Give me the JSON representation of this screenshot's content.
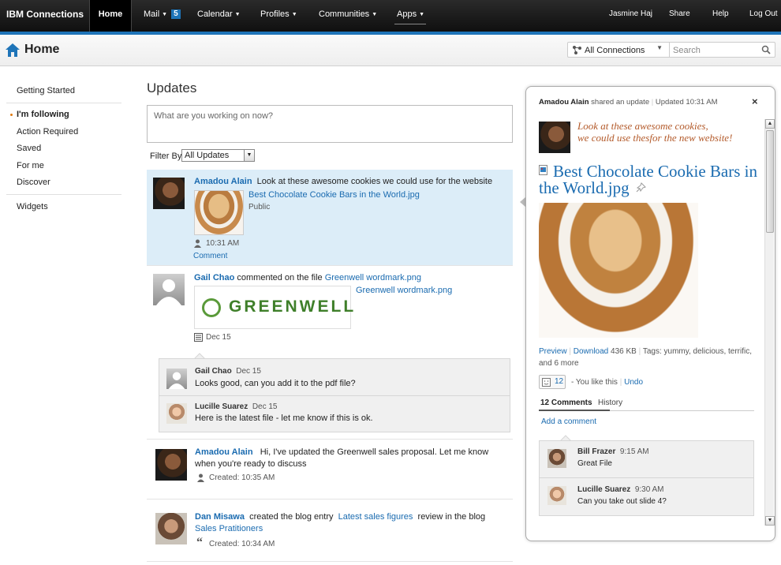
{
  "topnav": {
    "brand": "IBM Connections",
    "items": [
      "Home",
      "Mail",
      "Calendar",
      "Profiles",
      "Communities",
      "Apps"
    ],
    "mail_badge": "5",
    "user": "Jasmine Haj",
    "share": "Share",
    "help": "Help",
    "logout": "Log Out"
  },
  "header": {
    "title": "Home",
    "scope": "All Connections",
    "search_placeholder": "Search"
  },
  "leftnav": {
    "getting_started": "Getting Started",
    "items": [
      "I'm following",
      "Action Required",
      "Saved",
      "For me",
      "Discover"
    ],
    "widgets": "Widgets"
  },
  "main": {
    "title": "Updates",
    "status_placeholder": "What are you working on now?",
    "filter_label": "Filter By:",
    "filter_value": "All Updates"
  },
  "stories": [
    {
      "author": "Amadou Alain",
      "text": "Look at these awesome cookies we could use for the website",
      "file": "Best Chocolate Cookie Bars in the World.jpg",
      "visibility": "Public",
      "time": "10:31 AM",
      "action": "Comment"
    },
    {
      "author": "Gail Chao",
      "text": "commented on the file",
      "file": "Greenwell wordmark.png",
      "file2": "Greenwell wordmark.png",
      "logo_text": "GREENWELL",
      "date": "Dec 15",
      "comments": [
        {
          "author": "Gail Chao",
          "date": "Dec 15",
          "text": "Looks good, can you add it to the pdf file?"
        },
        {
          "author": "Lucille Suarez",
          "date": "Dec 15",
          "text": "Here is the latest file - let me know if this is ok."
        }
      ]
    },
    {
      "author": "Amadou Alain",
      "text_line1": "Hi, I've updated the Greenwell sales proposal.  Let me know",
      "text_line2": "when you're ready to discuss",
      "time": "Created: 10:35 AM"
    },
    {
      "author": "Dan Misawa",
      "text": "created the blog entry",
      "entry": "Latest sales figures",
      "text2": "review in the blog",
      "blog": "Sales Pratitioners",
      "time": "Created: 10:34 AM"
    }
  ],
  "flyout": {
    "author": "Amadou Alain",
    "action": "shared an update",
    "updated": "Updated 10:31 AM",
    "close": "×",
    "quote_line1": "Look at these awesome cookies,",
    "quote_line2": "we could use thesfor the new website!",
    "title_line1": "Best Chocolate Cookie Bars in",
    "title_line2": "the World.jpg",
    "preview": "Preview",
    "download": "Download",
    "size": "436 KB",
    "tags_line1": "Tags: yummy, delicious, terrific,",
    "tags_line2": "and 6 more",
    "likes": "12",
    "like_text": "- You like this",
    "undo": "Undo",
    "tab_comments": "12 Comments",
    "tab_history": "History",
    "add_comment": "Add a comment",
    "comments": [
      {
        "author": "Bill Frazer",
        "time": "9:15 AM",
        "text": "Great File"
      },
      {
        "author": "Lucille Suarez",
        "time": "9:30 AM",
        "text": "Can you take out slide 4?"
      }
    ]
  },
  "colors": {
    "accent": "#1e74b8",
    "link": "#1a6bb0",
    "highlight": "#dcedf8"
  }
}
